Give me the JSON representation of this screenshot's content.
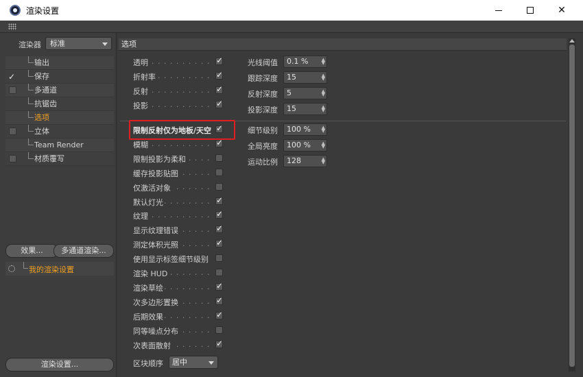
{
  "window": {
    "title": "渲染设置",
    "app_icon": "cinema4d-icon",
    "controls": [
      "minimize-icon",
      "maximize-icon",
      "close-icon"
    ]
  },
  "left": {
    "renderer_label": "渲染器",
    "renderer_value": "标准",
    "tree": [
      {
        "label": "输出",
        "checkbox": false,
        "checked": false,
        "active": false
      },
      {
        "label": "保存",
        "checkbox": false,
        "checked": true,
        "active": false
      },
      {
        "label": "多通道",
        "checkbox": true,
        "checked": false,
        "active": false
      },
      {
        "label": "抗锯齿",
        "checkbox": false,
        "checked": false,
        "active": false
      },
      {
        "label": "选项",
        "checkbox": false,
        "checked": false,
        "active": true
      },
      {
        "label": "立体",
        "checkbox": true,
        "checked": false,
        "active": false
      },
      {
        "label": "Team Render",
        "checkbox": false,
        "checked": false,
        "active": false
      },
      {
        "label": "材质覆写",
        "checkbox": true,
        "checked": false,
        "active": false
      }
    ],
    "effects_button": "效果...",
    "multipass_button": "多通道渲染...",
    "setting_name": "我的渲染设置",
    "render_settings_button": "渲染设置..."
  },
  "options": {
    "section_title": "选项",
    "group1": [
      {
        "label": "透明",
        "checked": true
      },
      {
        "label": "折射率",
        "checked": true
      },
      {
        "label": "反射",
        "checked": true
      },
      {
        "label": "投影",
        "checked": true
      }
    ],
    "group1_numeric": [
      {
        "label": "光线阈值",
        "value": "0.1 %"
      },
      {
        "label": "跟踪深度",
        "value": "15"
      },
      {
        "label": "反射深度",
        "value": "5"
      },
      {
        "label": "投影深度",
        "value": "15"
      }
    ],
    "group2": [
      {
        "label": "限制反射仅为地板/天空",
        "checked": true,
        "highlighted": true
      },
      {
        "label": "模糊",
        "checked": true
      },
      {
        "label": "限制投影为柔和",
        "checked": false
      },
      {
        "label": "缓存投影贴图",
        "checked": false
      },
      {
        "label": "仅激活对象",
        "checked": false
      },
      {
        "label": "默认灯光",
        "checked": true
      },
      {
        "label": "纹理",
        "checked": true
      },
      {
        "label": "显示纹理错误",
        "checked": true
      },
      {
        "label": "测定体积光照",
        "checked": true
      },
      {
        "label": "使用显示标签细节级别",
        "checked": false
      },
      {
        "label": "渲染 HUD",
        "checked": false
      },
      {
        "label": "渲染草绘",
        "checked": true
      },
      {
        "label": "次多边形置换",
        "checked": true
      },
      {
        "label": "后期效果",
        "checked": true
      },
      {
        "label": "同等噪点分布",
        "checked": false
      },
      {
        "label": "次表面散射",
        "checked": true
      }
    ],
    "group2_numeric": [
      {
        "label": "细节级别",
        "value": "100 %"
      },
      {
        "label": "全局亮度",
        "value": "100 %"
      },
      {
        "label": "运动比例",
        "value": "128"
      }
    ],
    "block_order_label": "区块顺序",
    "block_order_value": "居中"
  }
}
